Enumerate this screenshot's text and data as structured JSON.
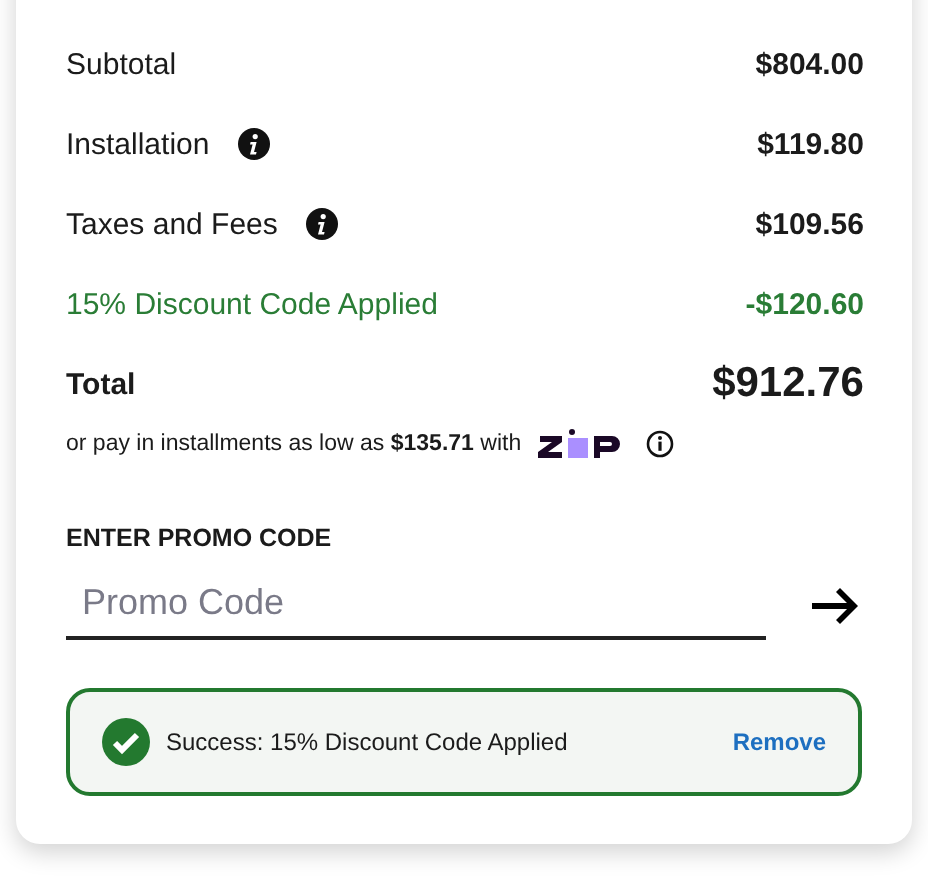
{
  "summary": {
    "lines": [
      {
        "label": "Subtotal",
        "value": "$804.00",
        "info": false,
        "kind": "normal"
      },
      {
        "label": "Installation",
        "value": "$119.80",
        "info": true,
        "kind": "normal"
      },
      {
        "label": "Taxes and Fees",
        "value": "$109.56",
        "info": true,
        "kind": "normal"
      },
      {
        "label": "15% Discount Code Applied",
        "value": "-$120.60",
        "info": false,
        "kind": "discount"
      }
    ],
    "total": {
      "label": "Total",
      "value": "$912.76"
    },
    "installments": "or pay in installments as low as **$135.71** with"
  },
  "promo": {
    "heading": "ENTER PROMO CODE",
    "placeholder": "Promo Code"
  },
  "alert": {
    "message": "Success: 15% Discount Code Applied",
    "action": "Remove"
  }
}
